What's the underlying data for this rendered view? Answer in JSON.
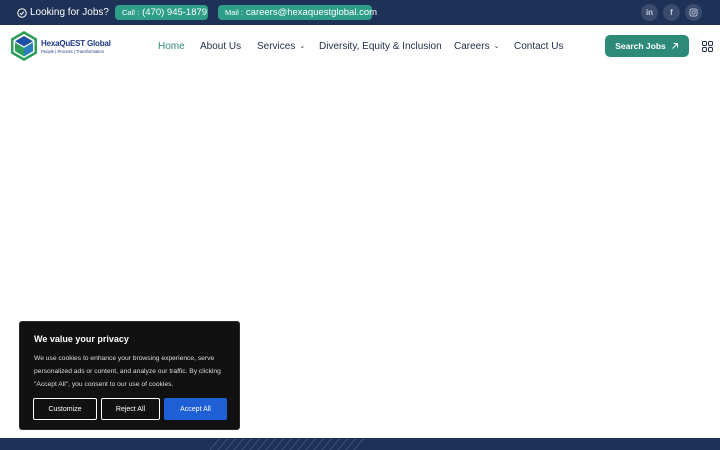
{
  "topbar": {
    "looking_label": "Looking for Jobs?",
    "call_prefix": "Call :",
    "call_number": "(470) 945-1879",
    "mail_prefix": "Mail :",
    "mail_address": "careers@hexaquestglobal.com",
    "social": [
      {
        "name": "linkedin-icon",
        "glyph": "in"
      },
      {
        "name": "facebook-icon",
        "glyph": "f"
      },
      {
        "name": "instagram-icon",
        "glyph": ""
      }
    ]
  },
  "logo": {
    "name": "HexaQuEST Global",
    "tagline": "People | Process | Transformation"
  },
  "nav": {
    "items": [
      {
        "label": "Home",
        "active": true
      },
      {
        "label": "About Us"
      },
      {
        "label": "Services",
        "has_dropdown": true
      },
      {
        "label": "Diversity, Equity & Inclusion"
      },
      {
        "label": "Careers",
        "has_dropdown": true
      },
      {
        "label": "Contact Us"
      }
    ],
    "search_label": "Search Jobs"
  },
  "cookie": {
    "title": "We value your privacy",
    "body": "We use cookies to enhance your browsing experience, serve personalized ads or content, and analyze our traffic. By clicking \"Accept All\", you consent to our use of cookies.",
    "customize_label": "Customize",
    "reject_label": "Reject All",
    "accept_label": "Accept All"
  },
  "colors": {
    "topbar_bg": "#1e3156",
    "accent_green": "#2e8a78",
    "pill_green": "#2e9e88",
    "accept_blue": "#1f5fd6",
    "cookie_bg": "#111111"
  }
}
